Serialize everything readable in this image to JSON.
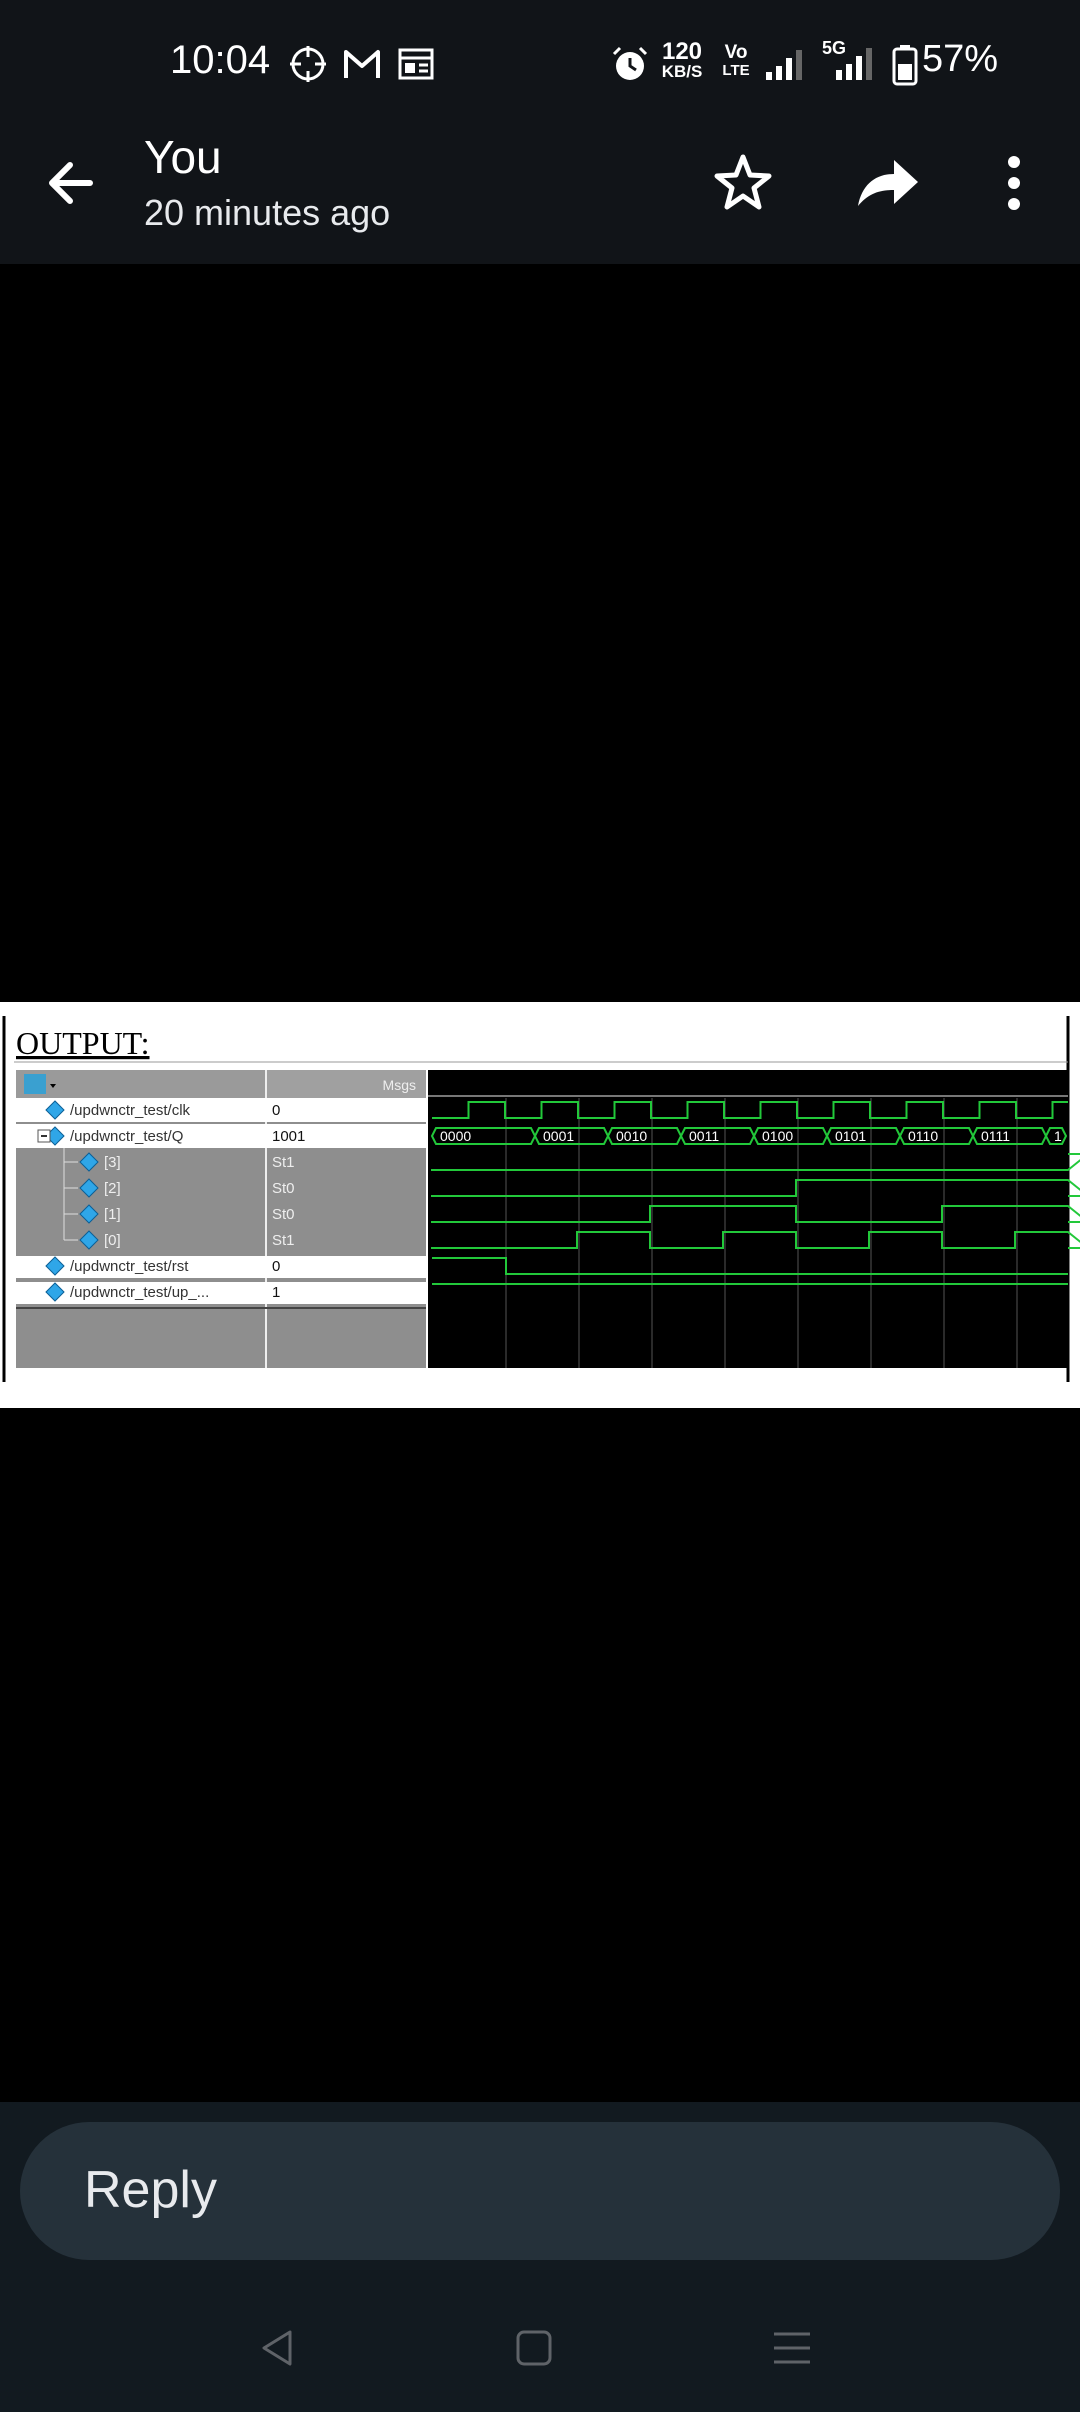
{
  "status_bar": {
    "time": "10:04",
    "net_speed_value": "120",
    "net_speed_unit": "KB/S",
    "volte_top": "Vo",
    "volte_bottom": "LTE",
    "network_5g": "5G",
    "battery": "57%",
    "icons": [
      "crosshair-icon",
      "gmail-icon",
      "news-icon",
      "alarm-icon",
      "signal-icon",
      "signal-5g-icon",
      "battery-icon"
    ]
  },
  "header": {
    "title": "You",
    "subtitle": "20 minutes ago",
    "actions": [
      "back-arrow-icon",
      "star-icon",
      "share-icon",
      "more-vert-icon"
    ]
  },
  "image": {
    "heading": "OUTPUT:",
    "msgs_header": "Msgs",
    "signals": [
      {
        "name": "/updwnctr_test/clk",
        "value": "0"
      },
      {
        "name": "/updwnctr_test/Q",
        "value": "1001"
      },
      {
        "name": "[3]",
        "value": "St1"
      },
      {
        "name": "[2]",
        "value": "St0"
      },
      {
        "name": "[1]",
        "value": "St0"
      },
      {
        "name": "[0]",
        "value": "St1"
      },
      {
        "name": "/updwnctr_test/rst",
        "value": "0"
      },
      {
        "name": "/updwnctr_test/up_...",
        "value": "1"
      }
    ],
    "q_values": [
      "0000",
      "0001",
      "0010",
      "0011",
      "0100",
      "0101",
      "0110",
      "0111",
      "1"
    ]
  },
  "reply": {
    "placeholder": "Reply"
  },
  "nav": [
    "back-nav-icon",
    "home-nav-icon",
    "recents-nav-icon"
  ],
  "colors": {
    "bar_bg": "#111418",
    "reply_pill": "#25313a",
    "wave_green": "#22c83a"
  }
}
